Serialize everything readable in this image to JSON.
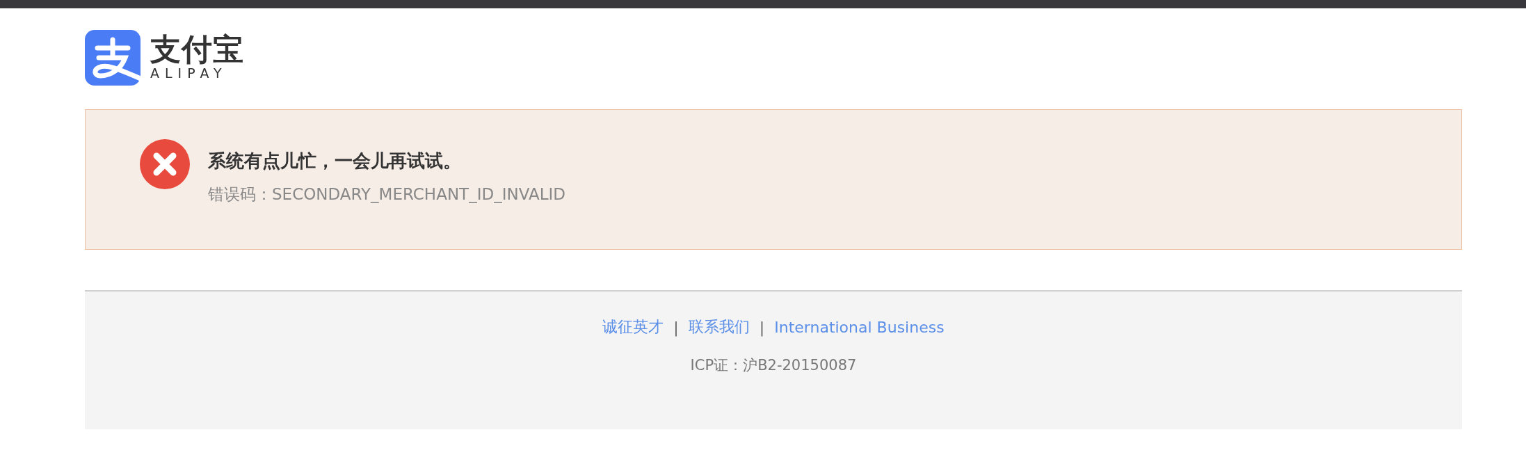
{
  "logo": {
    "name": "支付宝",
    "latin": "ALIPAY"
  },
  "error": {
    "title": "系统有点儿忙，一会儿再试试。",
    "code": "错误码：SECONDARY_MERCHANT_ID_INVALID"
  },
  "footer": {
    "links": [
      {
        "kind": "link",
        "label": "诚征英才"
      },
      {
        "kind": "separator",
        "label": "|"
      },
      {
        "kind": "link",
        "label": "联系我们"
      },
      {
        "kind": "separator",
        "label": "|"
      },
      {
        "kind": "link",
        "label": "International Business"
      }
    ],
    "license": "ICP证：沪B2-20150087"
  }
}
